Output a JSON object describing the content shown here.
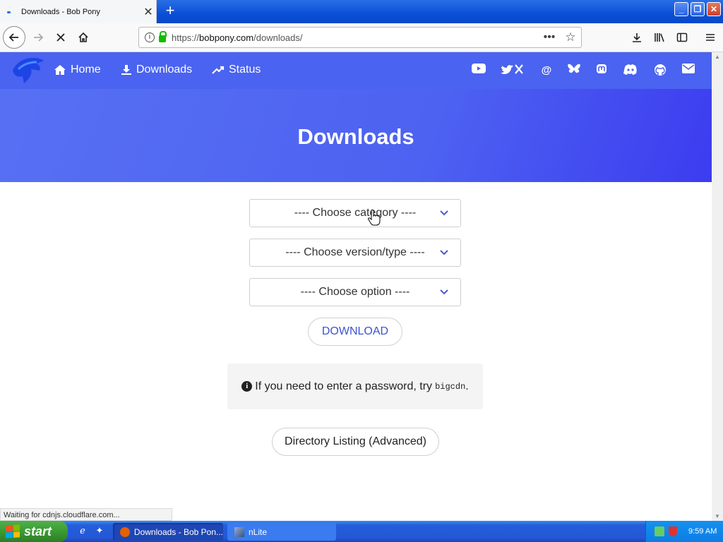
{
  "browser": {
    "tab_title": "Downloads - Bob Pony",
    "tab_close": "✕",
    "new_tab": "+",
    "url_prefix": "https://",
    "url_host": "bobpony.com",
    "url_path": "/downloads/",
    "status_text": "Waiting for cdnjs.cloudflare.com..."
  },
  "site": {
    "nav": [
      {
        "label": "Home",
        "icon": "home-icon"
      },
      {
        "label": "Downloads",
        "icon": "download-icon"
      },
      {
        "label": "Status",
        "icon": "trending-icon"
      }
    ],
    "social": [
      "youtube-icon",
      "x-twitter-icon",
      "threads-icon",
      "bluesky-icon",
      "mastodon-icon",
      "discord-icon",
      "github-icon",
      "email-icon"
    ],
    "hero_title": "Downloads"
  },
  "form": {
    "category_placeholder": "---- Choose category ----",
    "version_placeholder": "---- Choose version/type ----",
    "option_placeholder": "---- Choose option ----",
    "download_label": "DOWNLOAD",
    "notice_text": "If you need to enter a password, try",
    "notice_code": "bigcdn",
    "notice_end": ".",
    "directory_label": "Directory Listing (Advanced)"
  },
  "taskbar": {
    "start_label": "start",
    "tasks": [
      {
        "label": "Downloads - Bob Pon..."
      },
      {
        "label": "nLite"
      }
    ],
    "clock": "9:59 AM"
  },
  "colors": {
    "accent": "#4a63f0",
    "hero_end": "#3c3cf0",
    "link_blue": "#3b54cf"
  }
}
